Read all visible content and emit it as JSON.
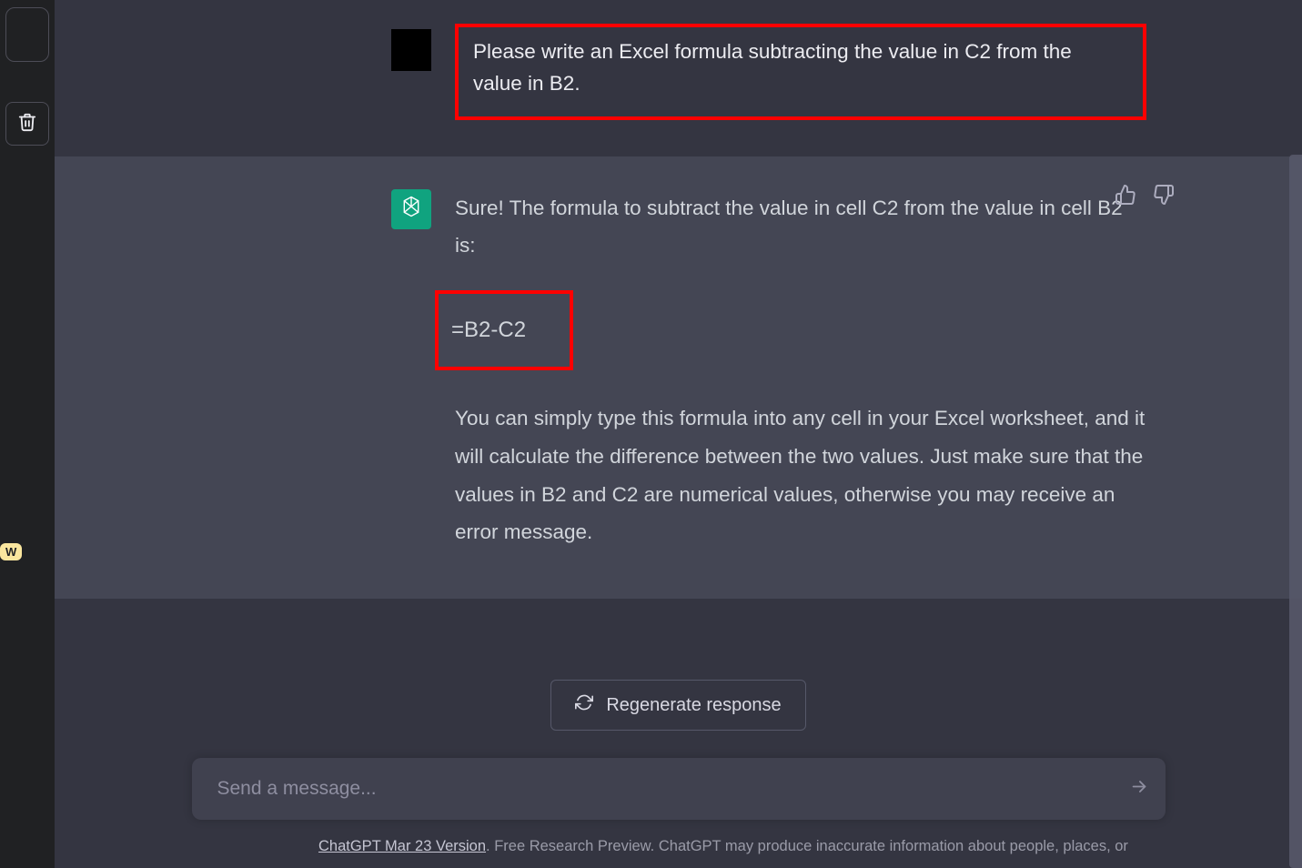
{
  "sidebar": {
    "badge": "W"
  },
  "conversation": {
    "user_message": "Please write an Excel formula subtracting the value in C2 from the value in B2.",
    "assistant_intro": "Sure! The formula to subtract the value in cell C2 from the value in cell B2 is:",
    "assistant_formula": "=B2-C2",
    "assistant_followup": "You can simply type this formula into any cell in your Excel worksheet, and it will calculate the difference between the two values. Just make sure that the values in B2 and C2 are numerical values, otherwise you may receive an error message."
  },
  "controls": {
    "regenerate_label": "Regenerate response"
  },
  "composer": {
    "placeholder": "Send a message..."
  },
  "footer": {
    "version_label": "ChatGPT Mar 23 Version",
    "disclaimer_tail": ". Free Research Preview. ChatGPT may produce inaccurate information about people, places, or"
  }
}
